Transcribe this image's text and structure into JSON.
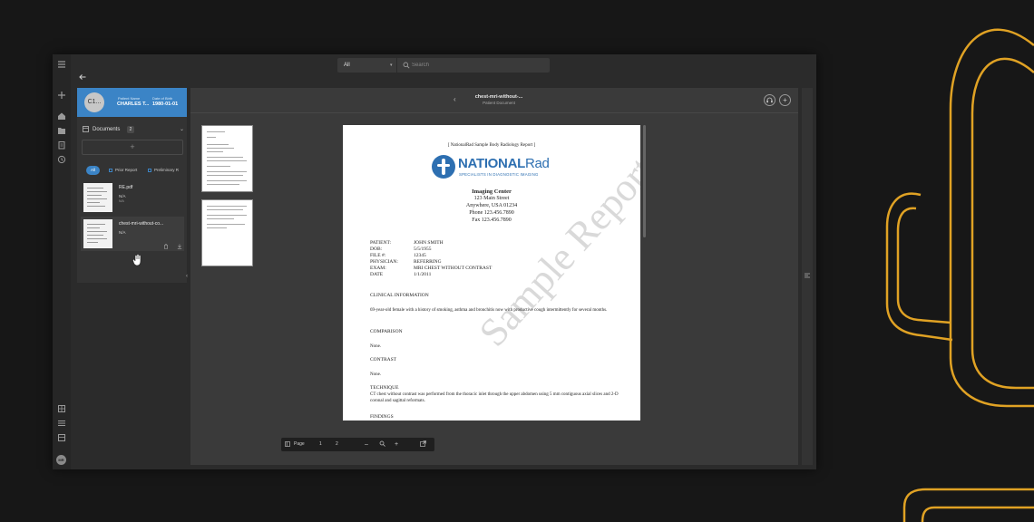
{
  "search": {
    "scope": "All",
    "placeholder": "Search"
  },
  "patient": {
    "initials": "C1...",
    "name_label": "Patient Name",
    "name_value": "CHARLES T...",
    "dob_label": "Date of Birth",
    "dob_value": "1980-01-01"
  },
  "documents": {
    "title": "Documents",
    "count": "2",
    "add_symbol": "+",
    "filters": [
      "All",
      "Prior Report",
      "Preliminary R"
    ],
    "items": [
      {
        "name": "RE.pdf",
        "sub": "N/A",
        "sub2": "N/A"
      },
      {
        "name": "chest-mri-without-co...",
        "sub": "N/A",
        "sub2": ""
      }
    ]
  },
  "viewer": {
    "title": "chest-mri-without-...",
    "subtitle": "Patient Document"
  },
  "report": {
    "header": "[ NationalRad Sample Body Radiology Report ]",
    "logo_name_bold": "NATIONAL",
    "logo_name_light": "Rad",
    "logo_tag": "SPECIALISTS IN DIAGNOSTIC IMAGING",
    "center_name": "Imaging Center",
    "address": [
      "123 Main Street",
      "Anywhere, USA 01234",
      "Phone 123.456.7890",
      "Fax 123.456.7890"
    ],
    "fields": [
      {
        "label": "PATIENT:",
        "value": "JOHN SMITH"
      },
      {
        "label": "DOB:",
        "value": "5/5/1955"
      },
      {
        "label": "FILE #:",
        "value": "12345"
      },
      {
        "label": "PHYSICIAN:",
        "value": "REFERRING"
      },
      {
        "label": "EXAM:",
        "value": "MRI CHEST WITHOUT CONTRAST"
      },
      {
        "label": "DATE",
        "value": "1/1/2011"
      }
    ],
    "clinical_title": "CLINICAL INFORMATION",
    "clinical_text": "69-year-old female with a history of smoking, asthma and bronchitis now with productive cough intermittently for several months.",
    "comparison_title": "COMPARISON",
    "comparison_text": "None.",
    "contrast_title": "CONTRAST",
    "contrast_text": "None.",
    "technique_title": "TECHNIQUE",
    "technique_text": "CT chest without contrast was performed from the thoracic inlet through the upper abdomen using 5 mm contiguous axial slices and 2-D coronal and sagittal reformats.",
    "findings_title": "FINDINGS",
    "watermark": "Sample Report"
  },
  "page_toolbar": {
    "page_label": "Page",
    "current_page": "1",
    "total_pages": "2",
    "zoom_out": "–",
    "zoom_in": "+"
  },
  "colors": {
    "accent": "#3b84c6",
    "deco": "#e0a224"
  }
}
